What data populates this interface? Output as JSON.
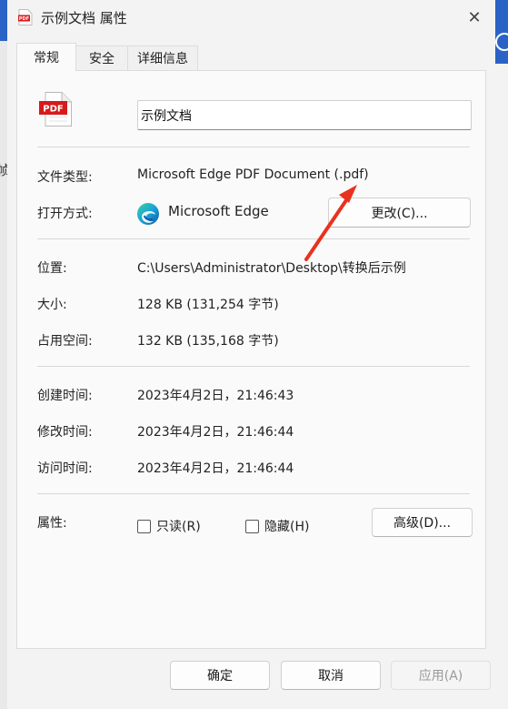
{
  "window": {
    "title": "示例文档 属性",
    "close_glyph": "✕"
  },
  "tabs": [
    {
      "label": "常规",
      "active": true
    },
    {
      "label": "安全",
      "active": false
    },
    {
      "label": "详细信息",
      "active": false
    }
  ],
  "general": {
    "file_icon_text": "PDF",
    "file_name": "示例文档",
    "file_type_label": "文件类型:",
    "file_type_value": "Microsoft Edge PDF Document (.pdf)",
    "opens_with_label": "打开方式:",
    "opens_with_app": "Microsoft Edge",
    "change_button": "更改(C)...",
    "location_label": "位置:",
    "location_value": "C:\\Users\\Administrator\\Desktop\\转换后示例",
    "size_label": "大小:",
    "size_value": "128 KB (131,254 字节)",
    "size_on_disk_label": "占用空间:",
    "size_on_disk_value": "132 KB (135,168 字节)",
    "created_label": "创建时间:",
    "created_value": "2023年4月2日，21:46:43",
    "modified_label": "修改时间:",
    "modified_value": "2023年4月2日，21:46:44",
    "accessed_label": "访问时间:",
    "accessed_value": "2023年4月2日，21:46:44",
    "attributes_label": "属性:",
    "readonly_label": "只读(R)",
    "readonly_checked": false,
    "hidden_label": "隐藏(H)",
    "hidden_checked": false,
    "advanced_button": "高级(D)..."
  },
  "footer": {
    "ok": "确定",
    "cancel": "取消",
    "apply": "应用(A)"
  },
  "background": {
    "left_edge_glyph": "帧"
  },
  "colors": {
    "pdf_red": "#d71a1a",
    "annotation_arrow": "#e8321f",
    "accent_blue": "#2a63c6"
  }
}
